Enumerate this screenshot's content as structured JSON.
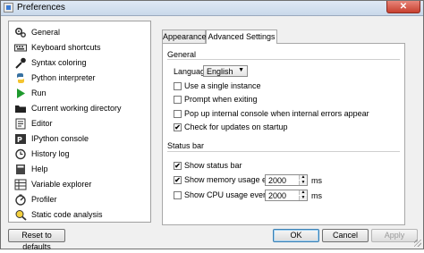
{
  "window": {
    "title": "Preferences",
    "close_glyph": "✕"
  },
  "sidebar": {
    "items": [
      {
        "label": "General",
        "icon": "gears-icon"
      },
      {
        "label": "Keyboard shortcuts",
        "icon": "keyboard-icon"
      },
      {
        "label": "Syntax coloring",
        "icon": "color-picker-icon"
      },
      {
        "label": "Python interpreter",
        "icon": "python-icon"
      },
      {
        "label": "Run",
        "icon": "run-icon"
      },
      {
        "label": "Current working directory",
        "icon": "folder-icon"
      },
      {
        "label": "Editor",
        "icon": "editor-icon"
      },
      {
        "label": "IPython console",
        "icon": "ipython-icon"
      },
      {
        "label": "History log",
        "icon": "history-icon"
      },
      {
        "label": "Help",
        "icon": "help-icon"
      },
      {
        "label": "Variable explorer",
        "icon": "variable-explorer-icon"
      },
      {
        "label": "Profiler",
        "icon": "profiler-icon"
      },
      {
        "label": "Static code analysis",
        "icon": "code-analysis-icon"
      }
    ]
  },
  "tabs": [
    {
      "label": "Appearance"
    },
    {
      "label": "Advanced Settings",
      "active": true
    }
  ],
  "general": {
    "title": "General",
    "language_label": "Language",
    "language_value": "English",
    "checkboxes": [
      {
        "label": "Use a single instance",
        "checked": false
      },
      {
        "label": "Prompt when exiting",
        "checked": false
      },
      {
        "label": "Pop up internal console when internal errors appear",
        "checked": false
      },
      {
        "label": "Check for updates on startup",
        "checked": true
      }
    ]
  },
  "status_bar": {
    "title": "Status bar",
    "show_status_bar": {
      "label": "Show status bar",
      "checked": true
    },
    "memory": {
      "label": "Show memory usage every",
      "checked": true,
      "value": "2000",
      "unit": "ms"
    },
    "cpu": {
      "label": "Show CPU usage every",
      "checked": false,
      "value": "2000",
      "unit": "ms"
    }
  },
  "buttons": {
    "reset": "Reset to defaults",
    "ok": "OK",
    "cancel": "Cancel",
    "apply": "Apply"
  },
  "glyphs": {
    "check": "✔",
    "arrow_down": "▼",
    "spin_up": "▲",
    "spin_down": "▼"
  }
}
